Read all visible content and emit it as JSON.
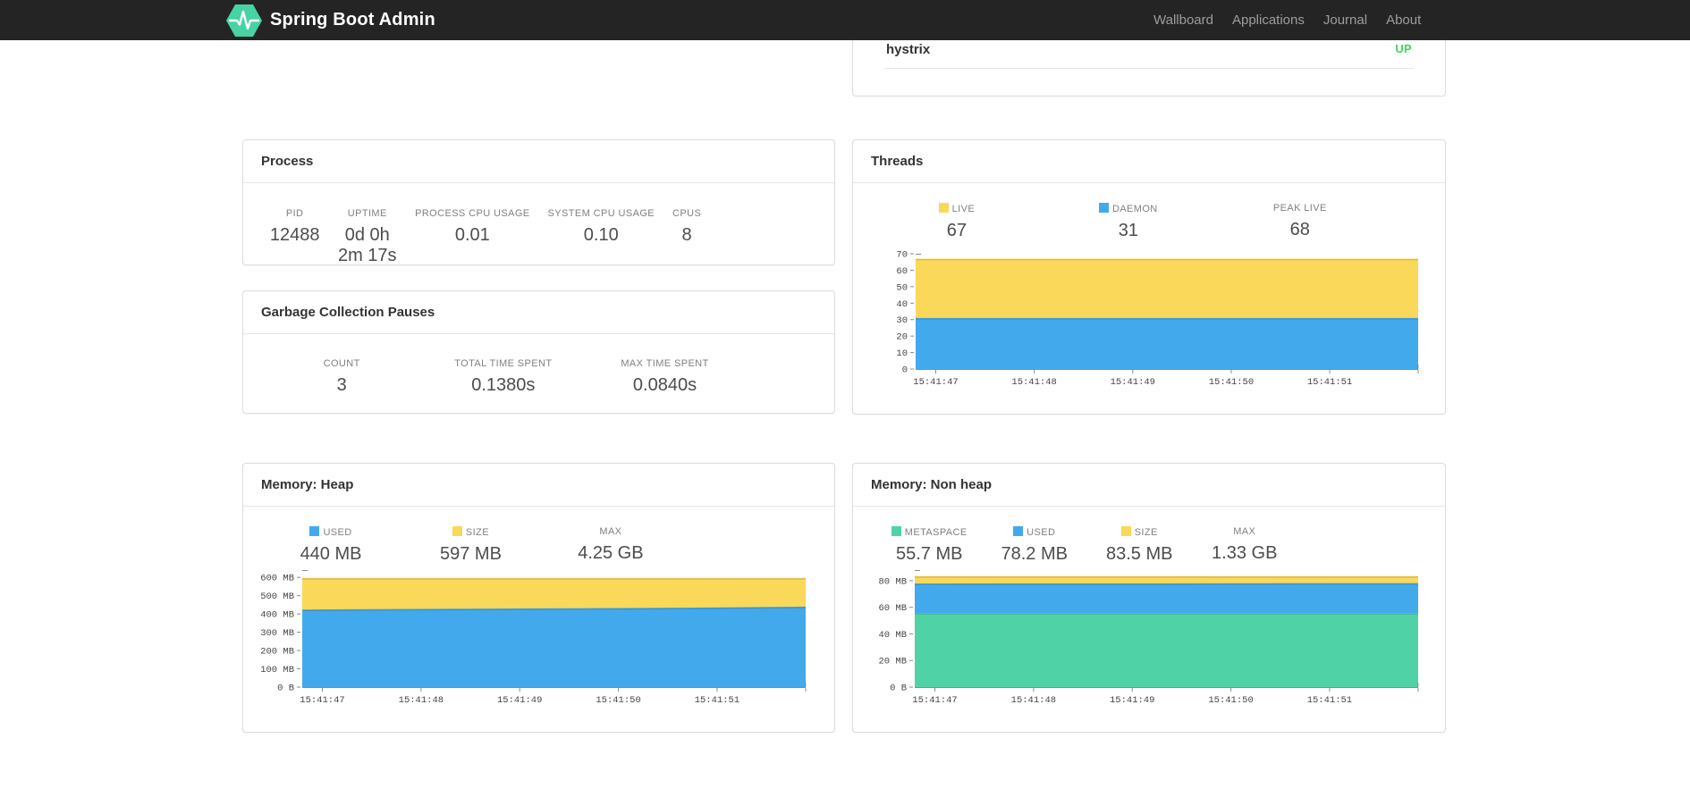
{
  "navbar": {
    "brand": "Spring Boot Admin",
    "logo_color": "#47d3a4",
    "background": "#242424",
    "links": [
      "Wallboard",
      "Applications",
      "Journal",
      "About"
    ]
  },
  "status_panel": {
    "app_name": "hystrix",
    "status": "UP",
    "status_color": "#42d35f"
  },
  "colors": {
    "series_yellow": "#FAD859",
    "series_blue": "#42AAEC",
    "series_green": "#4FD3A6"
  },
  "panels": {
    "process": {
      "title": "Process",
      "metrics": [
        {
          "label": "PID",
          "value": "12488"
        },
        {
          "label": "UPTIME",
          "value": "0d 0h 2m 17s"
        },
        {
          "label": "PROCESS CPU USAGE",
          "value": "0.01"
        },
        {
          "label": "SYSTEM CPU USAGE",
          "value": "0.10"
        },
        {
          "label": "CPUS",
          "value": "8"
        }
      ]
    },
    "gc": {
      "title": "Garbage Collection Pauses",
      "metrics": [
        {
          "label": "COUNT",
          "value": "3"
        },
        {
          "label": "TOTAL TIME SPENT",
          "value": "0.1380s"
        },
        {
          "label": "MAX TIME SPENT",
          "value": "0.0840s"
        }
      ]
    },
    "threads": {
      "title": "Threads",
      "metrics": [
        {
          "label": "LIVE",
          "value": "67",
          "swatch": "#FAD859"
        },
        {
          "label": "DAEMON",
          "value": "31",
          "swatch": "#42AAEC"
        },
        {
          "label": "PEAK LIVE",
          "value": "68"
        }
      ]
    },
    "heap": {
      "title": "Memory: Heap",
      "metrics": [
        {
          "label": "USED",
          "value": "440 MB",
          "swatch": "#42AAEC"
        },
        {
          "label": "SIZE",
          "value": "597 MB",
          "swatch": "#FAD859"
        },
        {
          "label": "MAX",
          "value": "4.25 GB"
        }
      ]
    },
    "nonheap": {
      "title": "Memory: Non heap",
      "metrics": [
        {
          "label": "METASPACE",
          "value": "55.7 MB",
          "swatch": "#4FD3A6"
        },
        {
          "label": "USED",
          "value": "78.2 MB",
          "swatch": "#42AAEC"
        },
        {
          "label": "SIZE",
          "value": "83.5 MB",
          "swatch": "#FAD859"
        },
        {
          "label": "MAX",
          "value": "1.33 GB"
        }
      ]
    }
  },
  "chart_data": [
    {
      "id": "threads",
      "type": "area",
      "title": "Threads",
      "xlabel": "",
      "ylabel": "",
      "grid": false,
      "legend_position": "top",
      "x_tick_labels": [
        "15:41:47",
        "15:41:48",
        "15:41:49",
        "15:41:50",
        "15:41:51"
      ],
      "ylim": [
        0,
        70
      ],
      "yticks": [
        {
          "v": 0,
          "label": "0"
        },
        {
          "v": 10,
          "label": "10"
        },
        {
          "v": 20,
          "label": "20"
        },
        {
          "v": 30,
          "label": "30"
        },
        {
          "v": 40,
          "label": "40"
        },
        {
          "v": 50,
          "label": "50"
        },
        {
          "v": 60,
          "label": "60"
        },
        {
          "v": 70,
          "label": "70"
        }
      ],
      "series": [
        {
          "name": "LIVE",
          "color": "#FAD859",
          "values": [
            67,
            67,
            67,
            67,
            67,
            67,
            67
          ]
        },
        {
          "name": "DAEMON",
          "color": "#42AAEC",
          "values": [
            31,
            31,
            31,
            31,
            31,
            31,
            31
          ]
        }
      ]
    },
    {
      "id": "heap",
      "type": "area",
      "title": "Memory: Heap (MB)",
      "xlabel": "",
      "ylabel": "",
      "grid": false,
      "legend_position": "top",
      "x_tick_labels": [
        "15:41:47",
        "15:41:48",
        "15:41:49",
        "15:41:50",
        "15:41:51"
      ],
      "ylim": [
        0,
        640
      ],
      "yticks": [
        {
          "v": 0,
          "label": "0 B"
        },
        {
          "v": 100,
          "label": "100 MB"
        },
        {
          "v": 200,
          "label": "200 MB"
        },
        {
          "v": 300,
          "label": "300 MB"
        },
        {
          "v": 400,
          "label": "400 MB"
        },
        {
          "v": 500,
          "label": "500 MB"
        },
        {
          "v": 600,
          "label": "600 MB"
        }
      ],
      "series": [
        {
          "name": "SIZE",
          "color": "#FAD859",
          "values": [
            597,
            597,
            597,
            597,
            597,
            597,
            597
          ]
        },
        {
          "name": "USED",
          "color": "#42AAEC",
          "values": [
            424,
            427,
            429,
            431,
            433,
            436,
            440
          ]
        }
      ]
    },
    {
      "id": "nonheap",
      "type": "area",
      "title": "Memory: Non heap (MB)",
      "xlabel": "",
      "ylabel": "",
      "grid": false,
      "legend_position": "top",
      "x_tick_labels": [
        "15:41:47",
        "15:41:48",
        "15:41:49",
        "15:41:50",
        "15:41:51"
      ],
      "ylim": [
        0,
        88
      ],
      "yticks": [
        {
          "v": 0,
          "label": "0 B"
        },
        {
          "v": 20,
          "label": "20 MB"
        },
        {
          "v": 40,
          "label": "40 MB"
        },
        {
          "v": 60,
          "label": "60 MB"
        },
        {
          "v": 80,
          "label": "80 MB"
        }
      ],
      "series": [
        {
          "name": "SIZE",
          "color": "#FAD859",
          "values": [
            83.5,
            83.5,
            83.5,
            83.5,
            83.5,
            83.5,
            83.5
          ]
        },
        {
          "name": "USED",
          "color": "#42AAEC",
          "values": [
            77.9,
            78.0,
            78.0,
            78.0,
            78.1,
            78.2,
            78.2
          ]
        },
        {
          "name": "METASPACE",
          "color": "#4FD3A6",
          "values": [
            55.7,
            55.7,
            55.7,
            55.7,
            55.7,
            55.7,
            55.7
          ]
        }
      ]
    }
  ]
}
